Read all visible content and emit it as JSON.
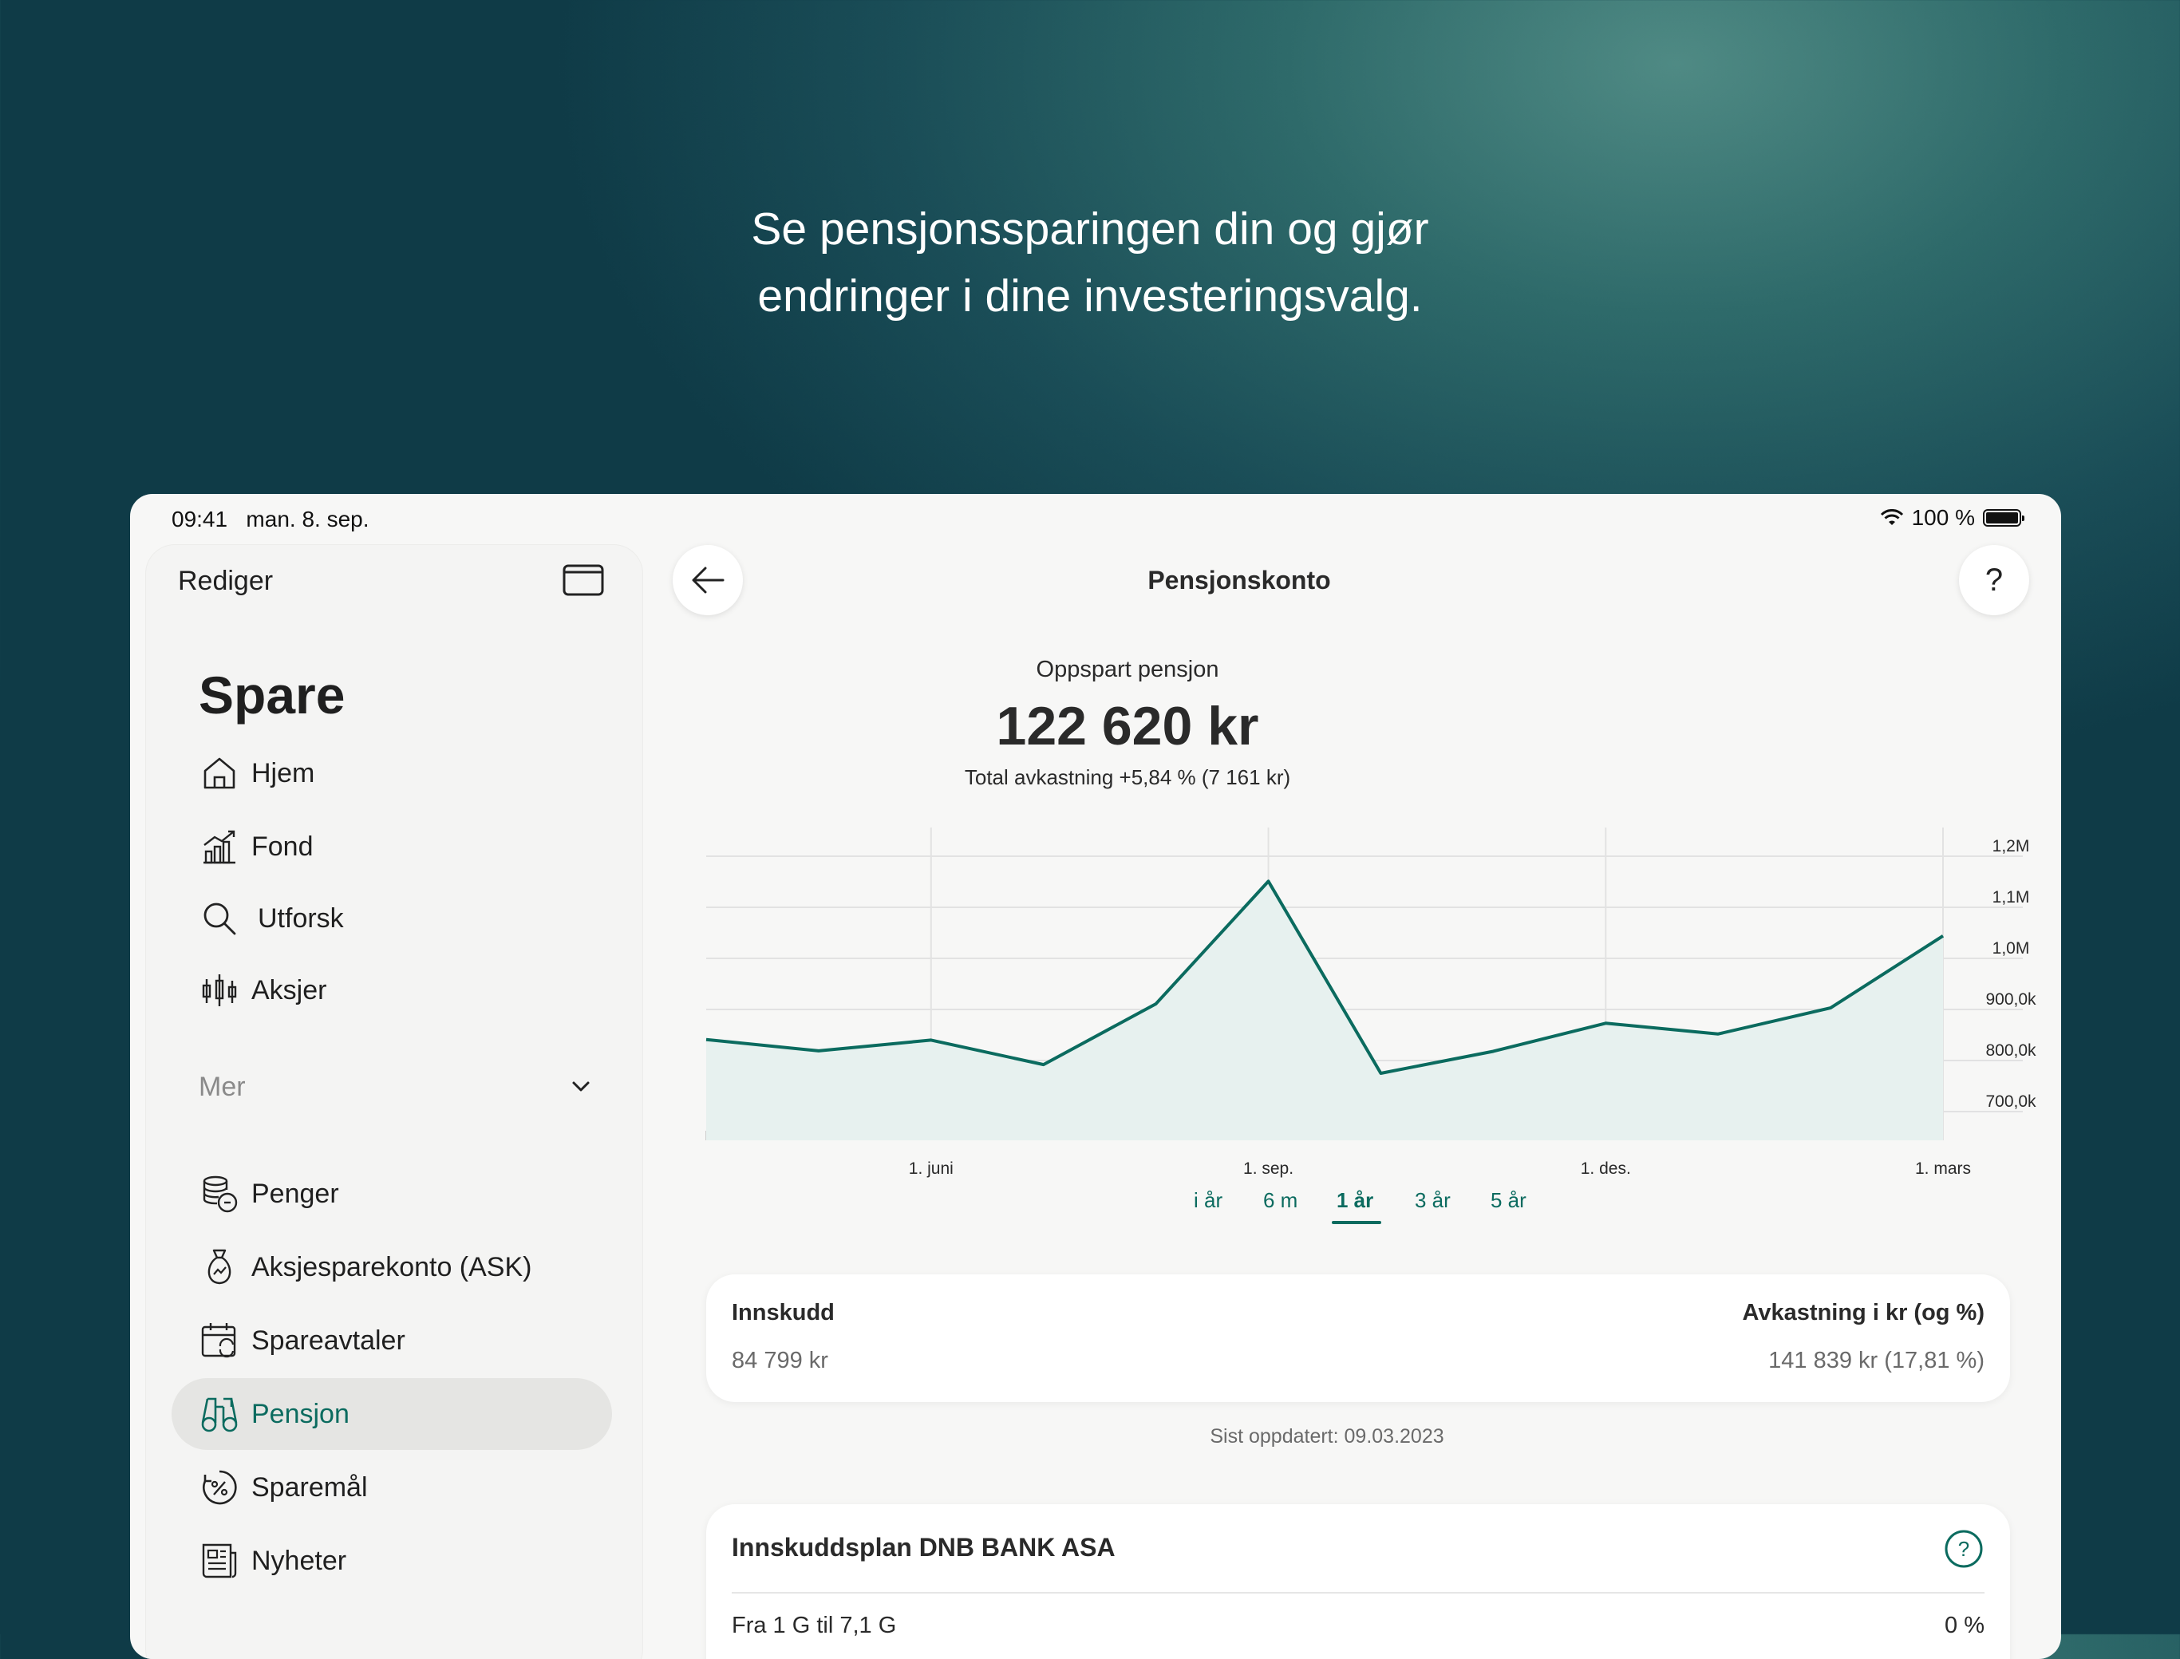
{
  "headline": {
    "line1": "Se pensjonssparingen din og gjør",
    "line2": "endringer i dine investeringsvalg."
  },
  "status_bar": {
    "time": "09:41",
    "date": "man. 8. sep.",
    "battery": "100 %"
  },
  "sidebar": {
    "edit_label": "Rediger",
    "title": "Spare",
    "items": [
      {
        "label": "Hjem",
        "icon": "home-icon"
      },
      {
        "label": "Fond",
        "icon": "chart-bars-icon"
      },
      {
        "label": "Utforsk",
        "icon": "search-icon"
      },
      {
        "label": "Aksjer",
        "icon": "candlestick-icon"
      }
    ],
    "more_label": "Mer",
    "more_items": [
      {
        "label": "Penger",
        "icon": "coins-icon"
      },
      {
        "label": "Aksjesparekonto (ASK)",
        "icon": "money-bag-icon"
      },
      {
        "label": "Spareavtaler",
        "icon": "calendar-repeat-icon"
      },
      {
        "label": "Pensjon",
        "icon": "binoculars-icon",
        "active": true
      },
      {
        "label": "Sparemål",
        "icon": "percent-target-icon"
      },
      {
        "label": "Nyheter",
        "icon": "newspaper-icon"
      }
    ]
  },
  "header": {
    "title": "Pensjonskonto"
  },
  "summary": {
    "label": "Oppspart pensjon",
    "amount": "122 620 kr",
    "return_text": "Total avkastning +5,84 % (7 161 kr)"
  },
  "chart_data": {
    "type": "area",
    "x": [
      "",
      "",
      "1. juni",
      "",
      "",
      "1. sep.",
      "",
      "",
      "1. des.",
      "",
      "",
      "1. mars"
    ],
    "values": [
      816,
      794,
      815,
      767,
      886,
      1126,
      750,
      793,
      848,
      827,
      878,
      1019
    ],
    "y_ticks": [
      "1,2M",
      "1,1M",
      "1,0M",
      "900,0k",
      "800,0k",
      "700,0k"
    ],
    "ylim": [
      650,
      1200
    ],
    "grid": true,
    "line_color": "#0b6b5f",
    "fill_color": "#e7f1ef"
  },
  "period_tabs": [
    {
      "label": "i år"
    },
    {
      "label": "6 m"
    },
    {
      "label": "1 år",
      "active": true
    },
    {
      "label": "3 år"
    },
    {
      "label": "5 år"
    }
  ],
  "deposit_card": {
    "left_title": "Innskudd",
    "left_value": "84 799 kr",
    "right_title": "Avkastning i kr (og %)",
    "right_value": "141 839 kr (17,81 %)"
  },
  "updated_text": "Sist oppdatert: 09.03.2023",
  "plan_card": {
    "title": "Innskuddsplan DNB BANK ASA",
    "row_label": "Fra 1 G til 7,1 G",
    "row_value": "0 %"
  },
  "colors": {
    "accent": "#0b6b5f",
    "background_dark": "#0f3b47"
  }
}
